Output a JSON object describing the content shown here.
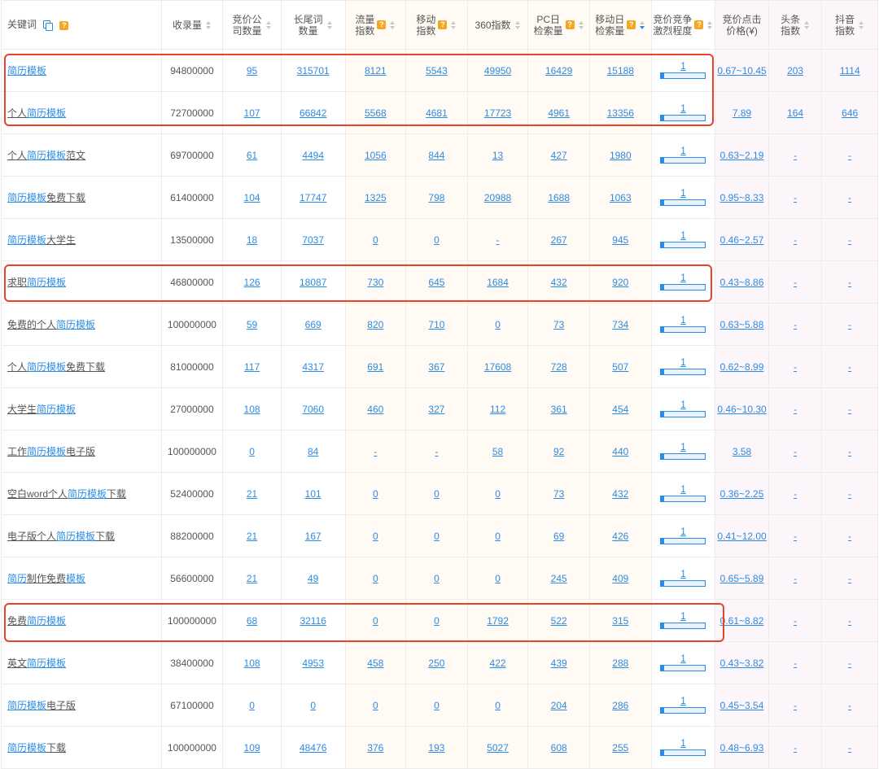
{
  "headers": {
    "keyword": "关键词",
    "indexed": "收录量",
    "bid_companies_1": "竞价公",
    "bid_companies_2": "司数量",
    "longtail_1": "长尾词",
    "longtail_2": "数量",
    "traffic_1": "流量",
    "traffic_2": "指数",
    "mobile_1": "移动",
    "mobile_2": "指数",
    "index360": "360指数",
    "pc_daily_1": "PC日",
    "pc_daily_2": "检索量",
    "mobile_daily_1": "移动日",
    "mobile_daily_2": "检索量",
    "competition_1": "竞价竞争",
    "competition_2": "激烈程度",
    "cpc_1": "竞价点击",
    "cpc_2": "价格(¥)",
    "toutiao_1": "头条",
    "toutiao_2": "指数",
    "douyin_1": "抖音",
    "douyin_2": "指数",
    "help_mark": "?"
  },
  "rows": [
    {
      "kw": [
        {
          "t": "简历模板",
          "hl": true
        }
      ],
      "indexed": "94800000",
      "bid": "95",
      "longtail": "315701",
      "traffic": "8121",
      "mobile": "5543",
      "i360": "49950",
      "pc": "16429",
      "mday": "15188",
      "comp": "1",
      "comp_level": 0.06,
      "cpc": "0.67~10.45",
      "toutiao": "203",
      "douyin": "1114"
    },
    {
      "kw": [
        {
          "t": "个人",
          "hl": false
        },
        {
          "t": "简历模板",
          "hl": true
        }
      ],
      "indexed": "72700000",
      "bid": "107",
      "longtail": "66842",
      "traffic": "5568",
      "mobile": "4681",
      "i360": "17723",
      "pc": "4961",
      "mday": "13356",
      "comp": "1",
      "comp_level": 0.06,
      "cpc": "7.89",
      "toutiao": "164",
      "douyin": "646"
    },
    {
      "kw": [
        {
          "t": "个人",
          "hl": false
        },
        {
          "t": "简历模板",
          "hl": true
        },
        {
          "t": "范文",
          "hl": false
        }
      ],
      "indexed": "69700000",
      "bid": "61",
      "longtail": "4494",
      "traffic": "1056",
      "mobile": "844",
      "i360": "13",
      "pc": "427",
      "mday": "1980",
      "comp": "1",
      "comp_level": 0.06,
      "cpc": "0.63~2.19",
      "toutiao": "-",
      "douyin": "-"
    },
    {
      "kw": [
        {
          "t": "简历模板",
          "hl": true
        },
        {
          "t": "免费下载",
          "hl": false
        }
      ],
      "indexed": "61400000",
      "bid": "104",
      "longtail": "17747",
      "traffic": "1325",
      "mobile": "798",
      "i360": "20988",
      "pc": "1688",
      "mday": "1063",
      "comp": "1",
      "comp_level": 0.06,
      "cpc": "0.95~8.33",
      "toutiao": "-",
      "douyin": "-"
    },
    {
      "kw": [
        {
          "t": "简历模板",
          "hl": true
        },
        {
          "t": "大学生",
          "hl": false
        }
      ],
      "indexed": "13500000",
      "bid": "18",
      "longtail": "7037",
      "traffic": "0",
      "mobile": "0",
      "i360": "-",
      "pc": "267",
      "mday": "945",
      "comp": "1",
      "comp_level": 0.06,
      "cpc": "0.46~2.57",
      "toutiao": "-",
      "douyin": "-"
    },
    {
      "kw": [
        {
          "t": "求职",
          "hl": false
        },
        {
          "t": "简历模板",
          "hl": true
        }
      ],
      "indexed": "46800000",
      "bid": "126",
      "longtail": "18087",
      "traffic": "730",
      "mobile": "645",
      "i360": "1684",
      "pc": "432",
      "mday": "920",
      "comp": "1",
      "comp_level": 0.06,
      "cpc": "0.43~8.86",
      "toutiao": "-",
      "douyin": "-"
    },
    {
      "kw": [
        {
          "t": "免费的个人",
          "hl": false
        },
        {
          "t": "简历模板",
          "hl": true
        }
      ],
      "indexed": "100000000",
      "bid": "59",
      "longtail": "669",
      "traffic": "820",
      "mobile": "710",
      "i360": "0",
      "pc": "73",
      "mday": "734",
      "comp": "1",
      "comp_level": 0.06,
      "cpc": "0.63~5.88",
      "toutiao": "-",
      "douyin": "-"
    },
    {
      "kw": [
        {
          "t": "个人",
          "hl": false
        },
        {
          "t": "简历模板",
          "hl": true
        },
        {
          "t": "免费下载",
          "hl": false
        }
      ],
      "indexed": "81000000",
      "bid": "117",
      "longtail": "4317",
      "traffic": "691",
      "mobile": "367",
      "i360": "17608",
      "pc": "728",
      "mday": "507",
      "comp": "1",
      "comp_level": 0.06,
      "cpc": "0.62~8.99",
      "toutiao": "-",
      "douyin": "-"
    },
    {
      "kw": [
        {
          "t": "大学生",
          "hl": false
        },
        {
          "t": "简历模板",
          "hl": true
        }
      ],
      "indexed": "27000000",
      "bid": "108",
      "longtail": "7060",
      "traffic": "460",
      "mobile": "327",
      "i360": "112",
      "pc": "361",
      "mday": "454",
      "comp": "1",
      "comp_level": 0.06,
      "cpc": "0.46~10.30",
      "toutiao": "-",
      "douyin": "-"
    },
    {
      "kw": [
        {
          "t": "工作",
          "hl": false
        },
        {
          "t": "简历模板",
          "hl": true
        },
        {
          "t": "电子版",
          "hl": false
        }
      ],
      "indexed": "100000000",
      "bid": "0",
      "longtail": "84",
      "traffic": "-",
      "mobile": "-",
      "i360": "58",
      "pc": "92",
      "mday": "440",
      "comp": "1",
      "comp_level": 0.06,
      "cpc": "3.58",
      "toutiao": "-",
      "douyin": "-"
    },
    {
      "kw": [
        {
          "t": "空白word个人",
          "hl": false
        },
        {
          "t": "简历模板",
          "hl": true
        },
        {
          "t": "下载",
          "hl": false
        }
      ],
      "indexed": "52400000",
      "bid": "21",
      "longtail": "101",
      "traffic": "0",
      "mobile": "0",
      "i360": "0",
      "pc": "73",
      "mday": "432",
      "comp": "1",
      "comp_level": 0.06,
      "cpc": "0.36~2.25",
      "toutiao": "-",
      "douyin": "-"
    },
    {
      "kw": [
        {
          "t": "电子版个人",
          "hl": false
        },
        {
          "t": "简历模板",
          "hl": true
        },
        {
          "t": "下载",
          "hl": false
        }
      ],
      "indexed": "88200000",
      "bid": "21",
      "longtail": "167",
      "traffic": "0",
      "mobile": "0",
      "i360": "0",
      "pc": "69",
      "mday": "426",
      "comp": "1",
      "comp_level": 0.06,
      "cpc": "0.41~12.00",
      "toutiao": "-",
      "douyin": "-"
    },
    {
      "kw": [
        {
          "t": "简历",
          "hl": true
        },
        {
          "t": "制作免费",
          "hl": false
        },
        {
          "t": "模板",
          "hl": true
        }
      ],
      "indexed": "56600000",
      "bid": "21",
      "longtail": "49",
      "traffic": "0",
      "mobile": "0",
      "i360": "0",
      "pc": "245",
      "mday": "409",
      "comp": "1",
      "comp_level": 0.06,
      "cpc": "0.65~5.89",
      "toutiao": "-",
      "douyin": "-"
    },
    {
      "kw": [
        {
          "t": "免费",
          "hl": false
        },
        {
          "t": "简历模板",
          "hl": true
        }
      ],
      "indexed": "100000000",
      "bid": "68",
      "longtail": "32116",
      "traffic": "0",
      "mobile": "0",
      "i360": "1792",
      "pc": "522",
      "mday": "315",
      "comp": "1",
      "comp_level": 0.06,
      "cpc": "0.61~8.82",
      "toutiao": "-",
      "douyin": "-"
    },
    {
      "kw": [
        {
          "t": "英文",
          "hl": false
        },
        {
          "t": "简历模板",
          "hl": true
        }
      ],
      "indexed": "38400000",
      "bid": "108",
      "longtail": "4953",
      "traffic": "458",
      "mobile": "250",
      "i360": "422",
      "pc": "439",
      "mday": "288",
      "comp": "1",
      "comp_level": 0.06,
      "cpc": "0.43~3.82",
      "toutiao": "-",
      "douyin": "-"
    },
    {
      "kw": [
        {
          "t": "简历模板",
          "hl": true
        },
        {
          "t": "电子版",
          "hl": false
        }
      ],
      "indexed": "67100000",
      "bid": "0",
      "longtail": "0",
      "traffic": "0",
      "mobile": "0",
      "i360": "0",
      "pc": "204",
      "mday": "286",
      "comp": "1",
      "comp_level": 0.06,
      "cpc": "0.45~3.54",
      "toutiao": "-",
      "douyin": "-"
    },
    {
      "kw": [
        {
          "t": "简历模板",
          "hl": true
        },
        {
          "t": "下载",
          "hl": false
        }
      ],
      "indexed": "100000000",
      "bid": "109",
      "longtail": "48476",
      "traffic": "376",
      "mobile": "193",
      "i360": "5027",
      "pc": "608",
      "mday": "255",
      "comp": "1",
      "comp_level": 0.06,
      "cpc": "0.48~6.93",
      "toutiao": "-",
      "douyin": "-"
    }
  ],
  "colors": {
    "link": "#2b8ce6",
    "help_badge": "#f5a623",
    "highlight_box": "#e8432a"
  }
}
